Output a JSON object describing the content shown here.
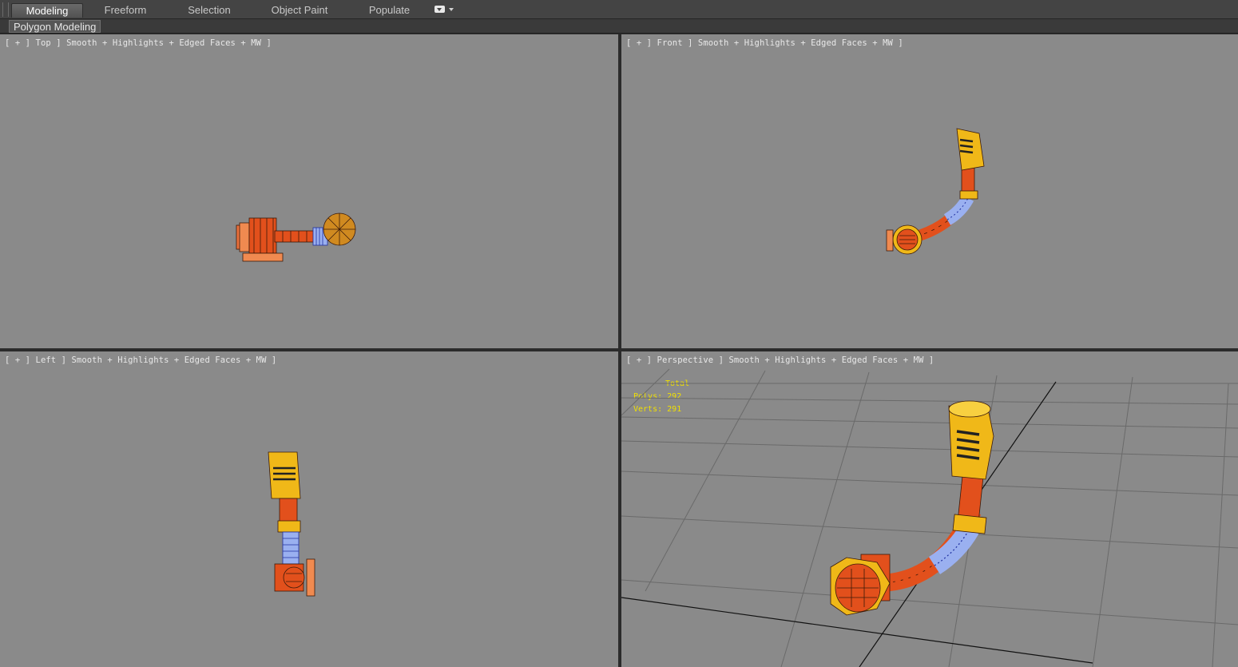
{
  "ribbon": {
    "tabs": [
      {
        "label": "Modeling",
        "active": true
      },
      {
        "label": "Freeform",
        "active": false
      },
      {
        "label": "Selection",
        "active": false
      },
      {
        "label": "Object Paint",
        "active": false
      },
      {
        "label": "Populate",
        "active": false
      }
    ],
    "more_icon": "dropdown-toggle-icon"
  },
  "panel": {
    "label": "Polygon Modeling"
  },
  "viewports": {
    "top": {
      "plus": "+",
      "view": "Top",
      "shading": "Smooth + Highlights + Edged Faces + MW"
    },
    "front": {
      "plus": "+",
      "view": "Front",
      "shading": "Smooth + Highlights + Edged Faces + MW"
    },
    "left": {
      "plus": "+",
      "view": "Left",
      "shading": "Smooth + Highlights + Edged Faces + MW"
    },
    "perspective": {
      "plus": "+",
      "view": "Perspective",
      "shading": "Smooth + Highlights + Edged Faces + MW",
      "stats": {
        "header": "Total",
        "polys_label": "Polys:",
        "polys": "292",
        "verts_label": "Verts:",
        "verts": "291"
      }
    }
  },
  "colors": {
    "viewport_bg": "#8a8a8a",
    "pipe_orange": "#e2501c",
    "brass": "#f0b818",
    "hose_blue": "#4a6fe0",
    "stats_text": "#f0e000"
  }
}
